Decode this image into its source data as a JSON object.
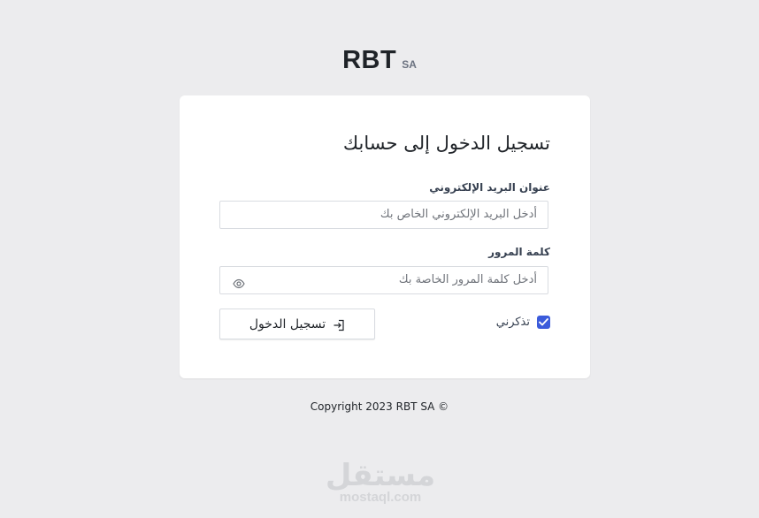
{
  "brand": {
    "name": "RBT",
    "suffix": "SA"
  },
  "form": {
    "title": "تسجيل الدخول إلى حسابك",
    "email_label": "عنوان البريد الإلكتروني",
    "email_placeholder": "أدخل البريد الإلكتروني الخاص بك",
    "email_value": "",
    "password_label": "كلمة المرور",
    "password_placeholder": "أدخل كلمة المرور الخاصة بك",
    "password_value": "",
    "remember_label": "تذكرني",
    "remember_checked": true,
    "submit_label": "تسجيل الدخول"
  },
  "footer": {
    "copyright": "Copyright 2023 RBT SA ©"
  },
  "watermark": {
    "arabic": "مستقل",
    "latin": "mostaql.com"
  },
  "colors": {
    "accent": "#3b5bdb",
    "background": "#ececee",
    "card": "#ffffff"
  },
  "icons": {
    "password_toggle": "eye-icon",
    "submit": "login-arrow-icon",
    "checkbox": "checkmark-icon"
  }
}
